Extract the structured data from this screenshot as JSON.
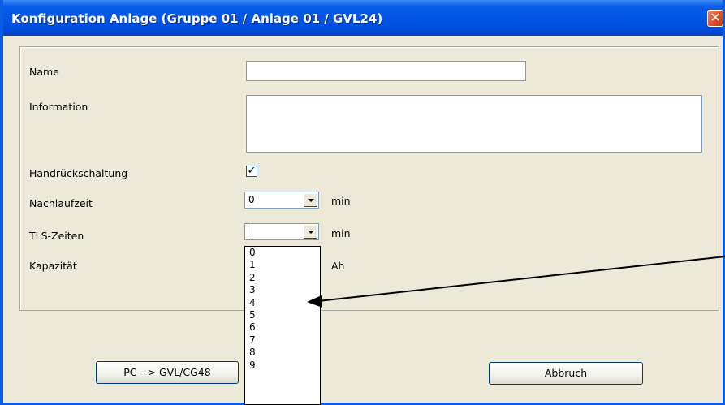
{
  "window": {
    "title": "Konfiguration Anlage (Gruppe 01 / Anlage 01 / GVL24)",
    "close_glyph": "✕"
  },
  "form": {
    "name_label": "Name",
    "name_value": "",
    "information_label": "Information",
    "information_value": "",
    "handrueck_label": "Handrückschaltung",
    "handrueck_checked": true,
    "check_glyph": "✓",
    "nachlauf_label": "Nachlaufzeit",
    "nachlauf_value": "0",
    "nachlauf_unit": "min",
    "tls_label": "TLS-Zeiten",
    "tls_value": "",
    "tls_unit": "min",
    "kapazitaet_label": "Kapazität",
    "kapazitaet_unit": "Ah"
  },
  "dropdown": {
    "items": [
      "0",
      "1",
      "2",
      "3",
      "4",
      "5",
      "6",
      "7",
      "8",
      "9"
    ]
  },
  "buttons": {
    "pc_to_gvl": "PC --> GVL/CG48",
    "abbruch": "Abbruch"
  },
  "colors": {
    "titlebar": "#0055e5",
    "window_bg": "#ece9d8",
    "close": "#e0502a"
  },
  "icons": {
    "close": "close-icon",
    "arrow": "annotation-arrow"
  }
}
